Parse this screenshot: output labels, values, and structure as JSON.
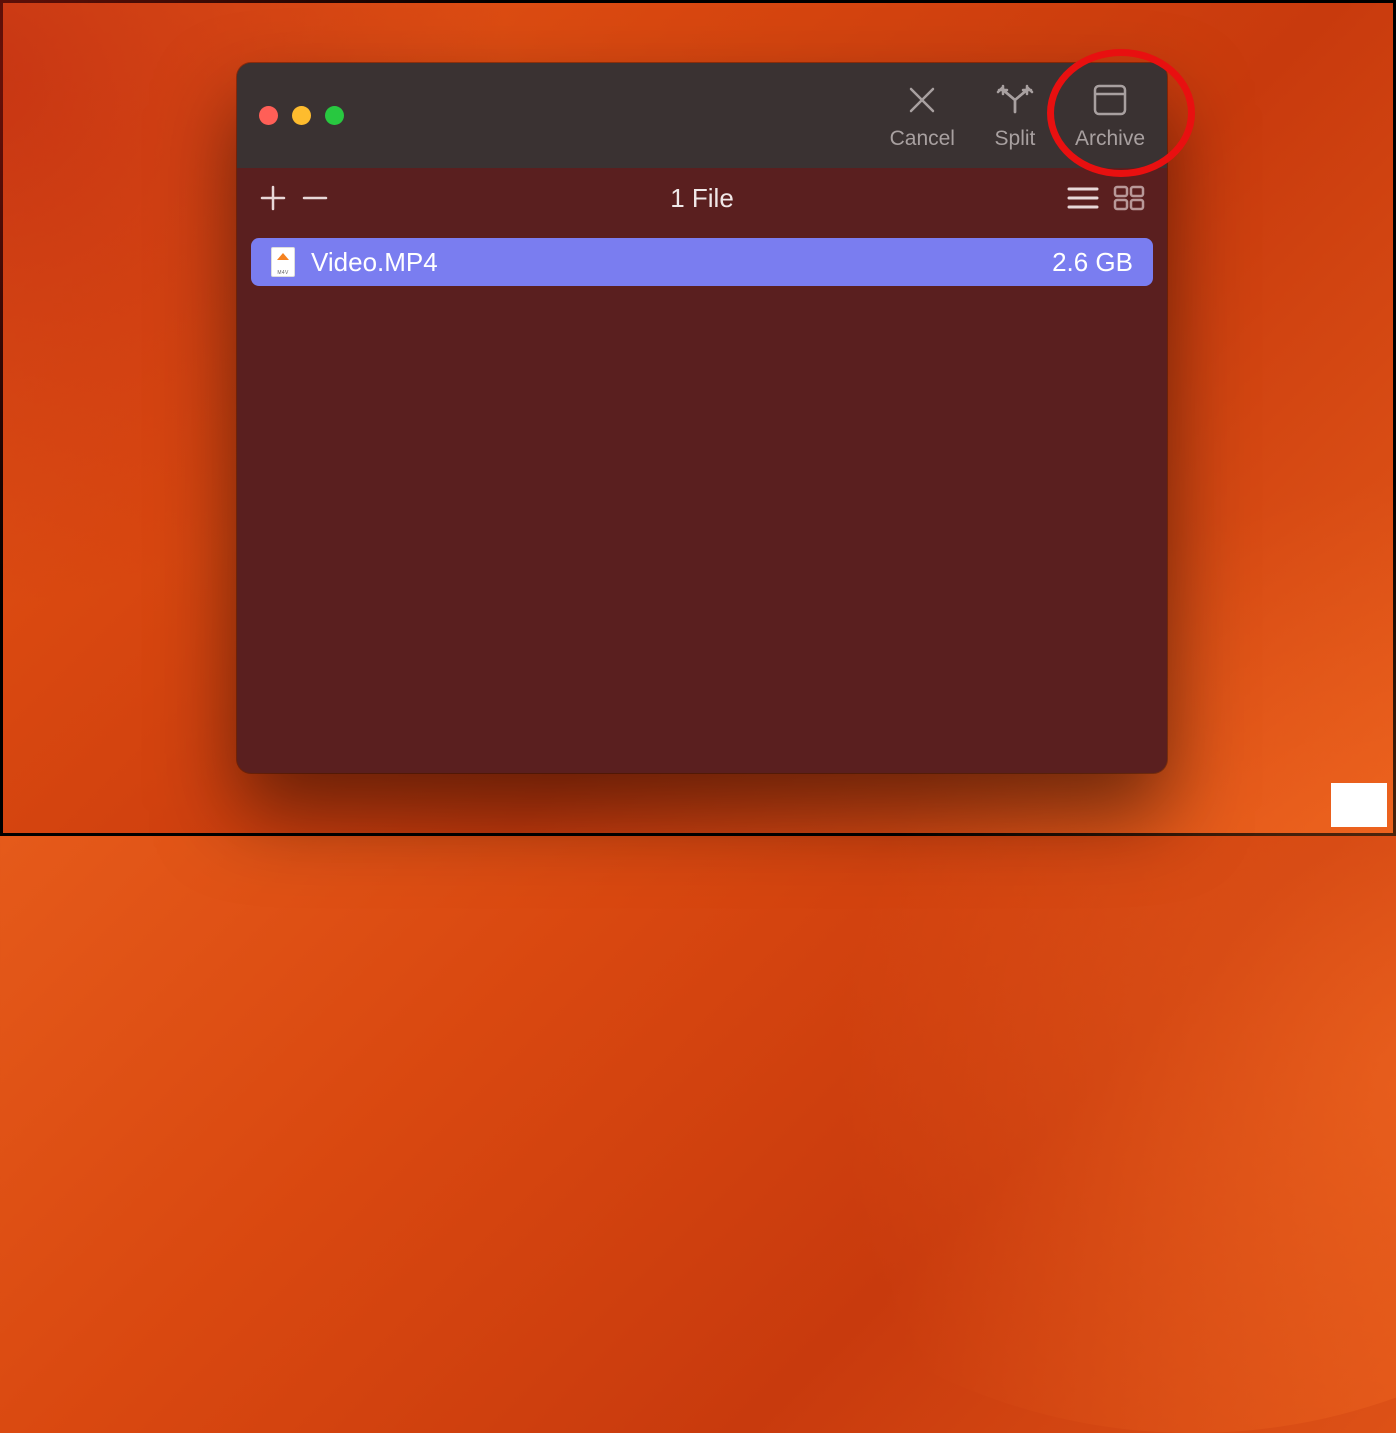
{
  "toolbar": {
    "cancel_label": "Cancel",
    "split_label": "Split",
    "archive_label": "Archive"
  },
  "subheader": {
    "file_count": "1 File"
  },
  "files": [
    {
      "name": "Video.MP4",
      "size": "2.6 GB",
      "icon": "video-file"
    }
  ],
  "annotation": {
    "highlighted_button": "archive"
  }
}
